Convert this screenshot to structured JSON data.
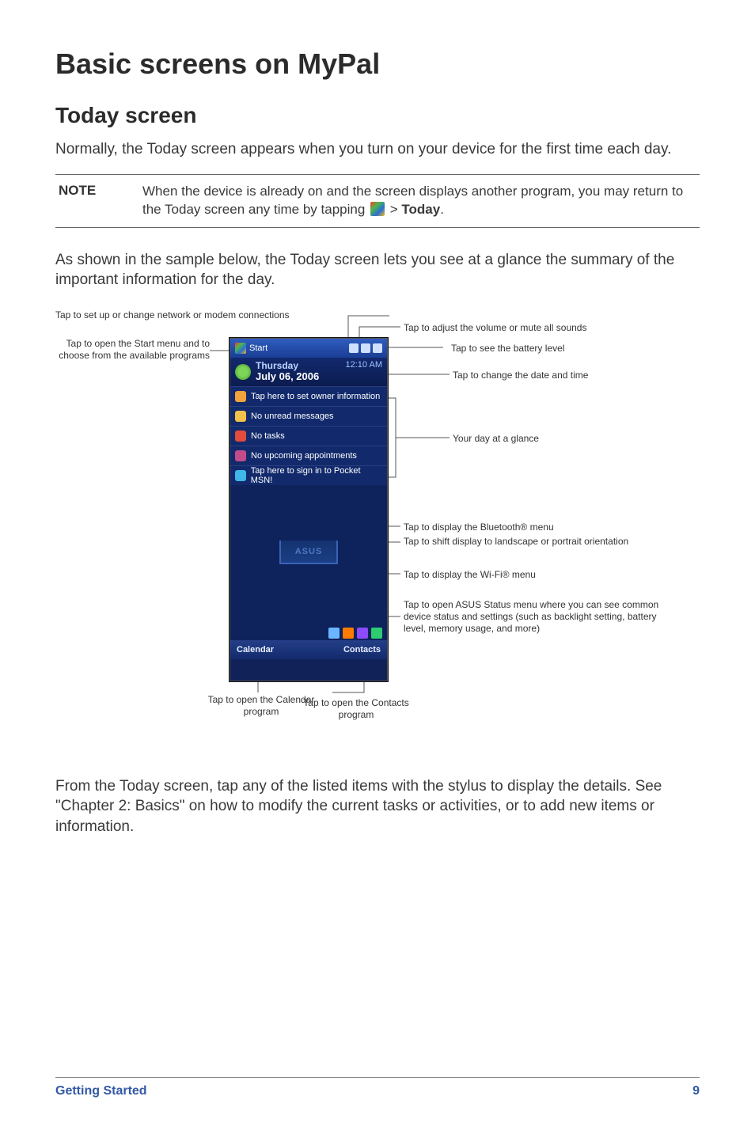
{
  "page": {
    "h1": "Basic screens on MyPal",
    "h2": "Today screen",
    "intro": "Normally, the Today screen appears when you turn on your device for the first time each day.",
    "after_diagram": "From the Today screen, tap any of the listed items with the stylus to display the details. See \"Chapter 2: Basics\" on how to modify the current tasks or activities, or to add new items or information.",
    "after_note": "As shown in the sample below, the Today screen lets you see at a glance the summary of the important information for the day."
  },
  "note": {
    "label": "NOTE",
    "text_before": "When the device is already on and the screen displays another program, you may return to the Today screen any time by tapping ",
    "text_after": " > ",
    "text_bold": "Today",
    "text_end": "."
  },
  "callouts": {
    "start_menu": "Tap to open the Start menu and to choose from the available programs",
    "network": "Tap to set up or change network or modem connections",
    "volume": "Tap to adjust the volume or mute all sounds",
    "battery": "Tap to see the battery level",
    "datetime": "Tap to change the date and time",
    "glance": "Your day at a glance",
    "bluetooth": "Tap to display the Bluetooth® menu",
    "orientation": "Tap to shift display to landscape or portrait orientation",
    "wifi": "Tap to display the Wi-Fi® menu",
    "asus_status": "Tap to open ASUS Status menu where you can see common device status and settings (such as backlight setting, battery level, memory usage, and more)",
    "calendar": "Tap to open the Calendar program",
    "contacts": "Tap to open the Contacts program"
  },
  "phone": {
    "start_label": "Start",
    "day": "Thursday",
    "date": "July 06, 2006",
    "time": "12:10 AM",
    "owner": "Tap here to set owner information",
    "messages": "No unread messages",
    "tasks": "No tasks",
    "appts": "No upcoming appointments",
    "msn": "Tap here to sign in to Pocket MSN!",
    "asus_logo": "ASUS",
    "sk_left": "Calendar",
    "sk_right": "Contacts"
  },
  "footer": {
    "title": "Getting Started",
    "page_number": "9"
  }
}
